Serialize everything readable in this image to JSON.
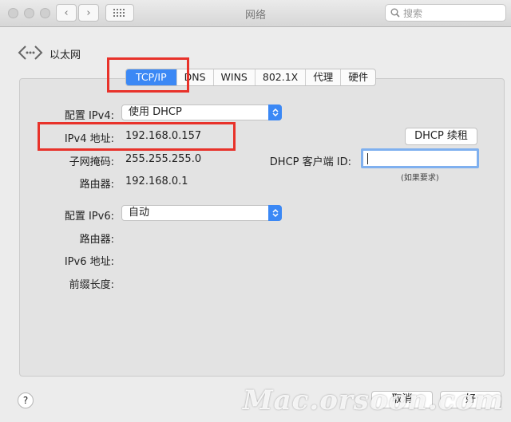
{
  "window": {
    "title": "网络"
  },
  "search": {
    "placeholder": "搜索"
  },
  "header": {
    "back_label": "以太网"
  },
  "tabs": [
    {
      "label": "TCP/IP",
      "active": true
    },
    {
      "label": "DNS",
      "active": false
    },
    {
      "label": "WINS",
      "active": false
    },
    {
      "label": "802.1X",
      "active": false
    },
    {
      "label": "代理",
      "active": false
    },
    {
      "label": "硬件",
      "active": false
    }
  ],
  "ipv4": {
    "config_label": "配置 IPv4:",
    "config_value": "使用 DHCP",
    "address_label": "IPv4 地址:",
    "address_value": "192.168.0.157",
    "subnet_label": "子网掩码:",
    "subnet_value": "255.255.255.0",
    "router_label": "路由器:",
    "router_value": "192.168.0.1"
  },
  "dhcp": {
    "renew_label": "DHCP 续租",
    "client_id_label": "DHCP 客户端 ID:",
    "client_id_value": "",
    "client_id_hint": "(如果要求)"
  },
  "ipv6": {
    "config_label": "配置 IPv6:",
    "config_value": "自动",
    "router_label": "路由器:",
    "address_label": "IPv6 地址:",
    "prefix_label": "前缀长度:"
  },
  "footer": {
    "help_label": "?",
    "cancel_label": "取消",
    "ok_label": "好"
  },
  "watermark": {
    "text": "Mac.orsoon.com"
  },
  "colors": {
    "accent": "#3b88f5",
    "highlight_box": "#e8322a"
  }
}
